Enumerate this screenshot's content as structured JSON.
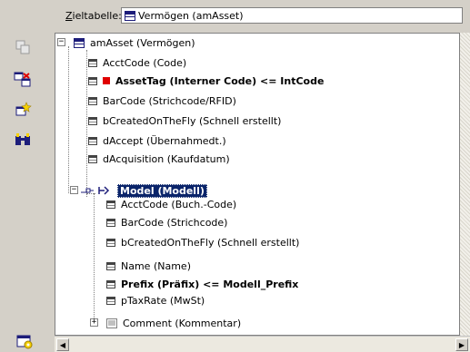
{
  "header": {
    "label_prefix": "Z",
    "label_rest": "ieltabelle:",
    "value": "Vermögen (amAsset)"
  },
  "tree": {
    "root": "amAsset (Vermögen)",
    "items": [
      {
        "label": "AcctCode (Code)"
      },
      {
        "label": "AssetTag (Interner Code)  <=  IntCode"
      },
      {
        "label": "BarCode (Strichcode/RFID)"
      },
      {
        "label": "bCreatedOnTheFly (Schnell erstellt)"
      },
      {
        "label": "dAccept (Übernahmedt.)"
      },
      {
        "label": "dAcquisition (Kaufdatum)"
      }
    ],
    "model": {
      "label": "Model (Modell)",
      "children": [
        {
          "label": "AcctCode (Buch.-Code)"
        },
        {
          "label": "BarCode (Strichcode)"
        },
        {
          "label": "bCreatedOnTheFly (Schnell erstellt)"
        },
        {
          "label": "Name (Name)"
        },
        {
          "label": "Prefix (Präfix)  <=  Modell_Prefix"
        },
        {
          "label": "pTaxRate (MwSt)"
        },
        {
          "label": "Comment (Kommentar)"
        }
      ]
    }
  },
  "icons": {
    "toolbar": [
      "copy-icon",
      "map-field-icon",
      "new-calc-field-icon",
      "find-icon",
      "settings-icon"
    ]
  },
  "colors": {
    "selection": "#0a246a",
    "marker": "#e00000",
    "background": "#d4d0c8"
  }
}
